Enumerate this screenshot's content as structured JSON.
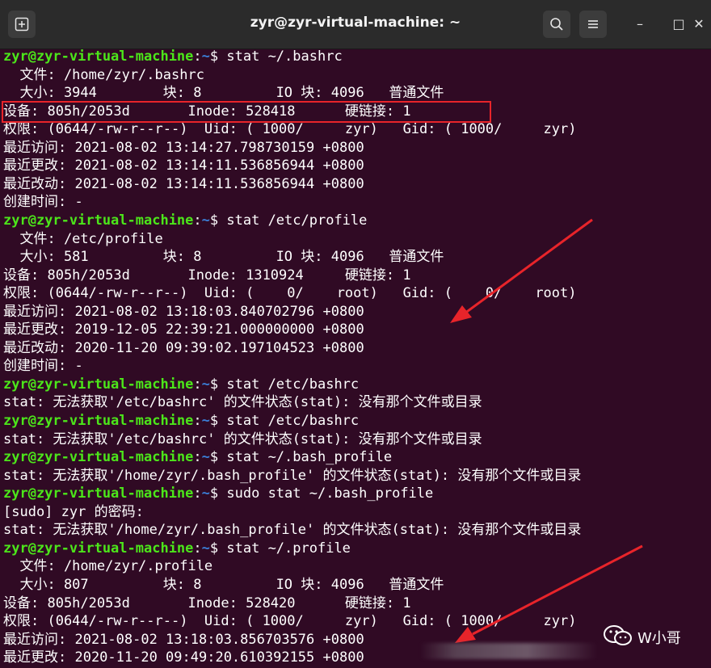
{
  "window": {
    "title": "zyr@zyr-virtual-machine: ~",
    "search_icon": "search-icon",
    "menu_icon": "hamburger-menu-icon",
    "minimize": "–",
    "maximize": "□",
    "close": "✕"
  },
  "prompt": {
    "user": "zyr@zyr-virtual-machine",
    "sep": ":",
    "path": "~",
    "dollar": "$"
  },
  "lines": [
    {
      "type": "prompt",
      "cmd": " stat ~/.bashrc"
    },
    {
      "type": "out",
      "text": "  文件: /home/zyr/.bashrc"
    },
    {
      "type": "out",
      "text": "  大小: 3944        块: 8         IO 块: 4096   普通文件"
    },
    {
      "type": "out",
      "text": "设备: 805h/2053d       Inode: 528418      硬链接: 1"
    },
    {
      "type": "out",
      "text": "权限: (0644/-rw-r--r--)  Uid: ( 1000/     zyr)   Gid: ( 1000/     zyr)"
    },
    {
      "type": "out",
      "text": "最近访问: 2021-08-02 13:14:27.798730159 +0800"
    },
    {
      "type": "out",
      "text": "最近更改: 2021-08-02 13:14:11.536856944 +0800"
    },
    {
      "type": "out",
      "text": "最近改动: 2021-08-02 13:14:11.536856944 +0800"
    },
    {
      "type": "out",
      "text": "创建时间: -"
    },
    {
      "type": "prompt",
      "cmd": " stat /etc/profile"
    },
    {
      "type": "out",
      "text": "  文件: /etc/profile"
    },
    {
      "type": "out",
      "text": "  大小: 581         块: 8         IO 块: 4096   普通文件"
    },
    {
      "type": "out",
      "text": "设备: 805h/2053d       Inode: 1310924     硬链接: 1"
    },
    {
      "type": "out",
      "text": "权限: (0644/-rw-r--r--)  Uid: (    0/    root)   Gid: (    0/    root)"
    },
    {
      "type": "out",
      "text": "最近访问: 2021-08-02 13:18:03.840702796 +0800"
    },
    {
      "type": "out",
      "text": "最近更改: 2019-12-05 22:39:21.000000000 +0800"
    },
    {
      "type": "out",
      "text": "最近改动: 2020-11-20 09:39:02.197104523 +0800"
    },
    {
      "type": "out",
      "text": "创建时间: -"
    },
    {
      "type": "prompt",
      "cmd": " stat /etc/bashrc"
    },
    {
      "type": "out",
      "text": "stat: 无法获取'/etc/bashrc' 的文件状态(stat): 没有那个文件或目录"
    },
    {
      "type": "prompt",
      "cmd": " stat /etc/bashrc"
    },
    {
      "type": "out",
      "text": "stat: 无法获取'/etc/bashrc' 的文件状态(stat): 没有那个文件或目录"
    },
    {
      "type": "prompt",
      "cmd": " stat ~/.bash_profile"
    },
    {
      "type": "out",
      "text": "stat: 无法获取'/home/zyr/.bash_profile' 的文件状态(stat): 没有那个文件或目录"
    },
    {
      "type": "prompt",
      "cmd": " sudo stat ~/.bash_profile"
    },
    {
      "type": "out",
      "text": "[sudo] zyr 的密码:"
    },
    {
      "type": "out",
      "text": "stat: 无法获取'/home/zyr/.bash_profile' 的文件状态(stat): 没有那个文件或目录"
    },
    {
      "type": "prompt",
      "cmd": " stat ~/.profile"
    },
    {
      "type": "out",
      "text": "  文件: /home/zyr/.profile"
    },
    {
      "type": "out",
      "text": "  大小: 807         块: 8         IO 块: 4096   普通文件"
    },
    {
      "type": "out",
      "text": "设备: 805h/2053d       Inode: 528420      硬链接: 1"
    },
    {
      "type": "out",
      "text": "权限: (0644/-rw-r--r--)  Uid: ( 1000/     zyr)   Gid: ( 1000/     zyr)"
    },
    {
      "type": "out",
      "text": "最近访问: 2021-08-02 13:18:03.856703576 +0800"
    },
    {
      "type": "out",
      "text": "最近更改: 2020-11-20 09:49:20.610392155 +0800"
    }
  ],
  "watermark": {
    "icon": "wechat-icon",
    "text": "W小哥"
  },
  "colors": {
    "terminal_bg": "#300a24",
    "prompt_user": "#4ce61a",
    "prompt_path": "#3b7fd8",
    "highlight_box": "#e8242a",
    "arrow": "#e8242a"
  }
}
